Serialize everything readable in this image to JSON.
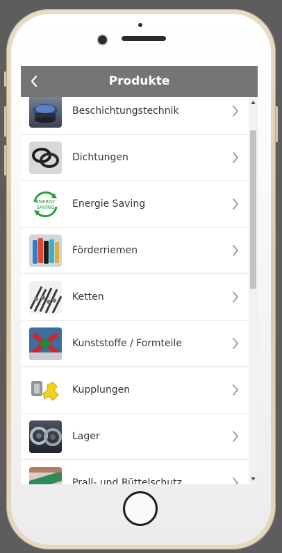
{
  "header": {
    "title": "Produkte",
    "back_icon": "chevron-left-icon"
  },
  "products": [
    {
      "label": "Beschichtungstechnik",
      "icon": "coating-image"
    },
    {
      "label": "Dichtungen",
      "icon": "seals-image"
    },
    {
      "label": "Energie Saving",
      "icon": "energy-saving-image",
      "icon_text_1": "ENERGY",
      "icon_text_2": "SAVING"
    },
    {
      "label": "Förderriemen",
      "icon": "conveyor-belts-image"
    },
    {
      "label": "Ketten",
      "icon": "chains-image"
    },
    {
      "label": "Kunststoffe / Formteile",
      "icon": "plastics-image"
    },
    {
      "label": "Kupplungen",
      "icon": "couplings-image"
    },
    {
      "label": "Lager",
      "icon": "bearings-image"
    },
    {
      "label": "Prall- und Rüttelschutz",
      "icon": "impact-protection-image"
    }
  ],
  "colors": {
    "header_bg": "#757575",
    "accent_green": "#2a9d3a"
  }
}
